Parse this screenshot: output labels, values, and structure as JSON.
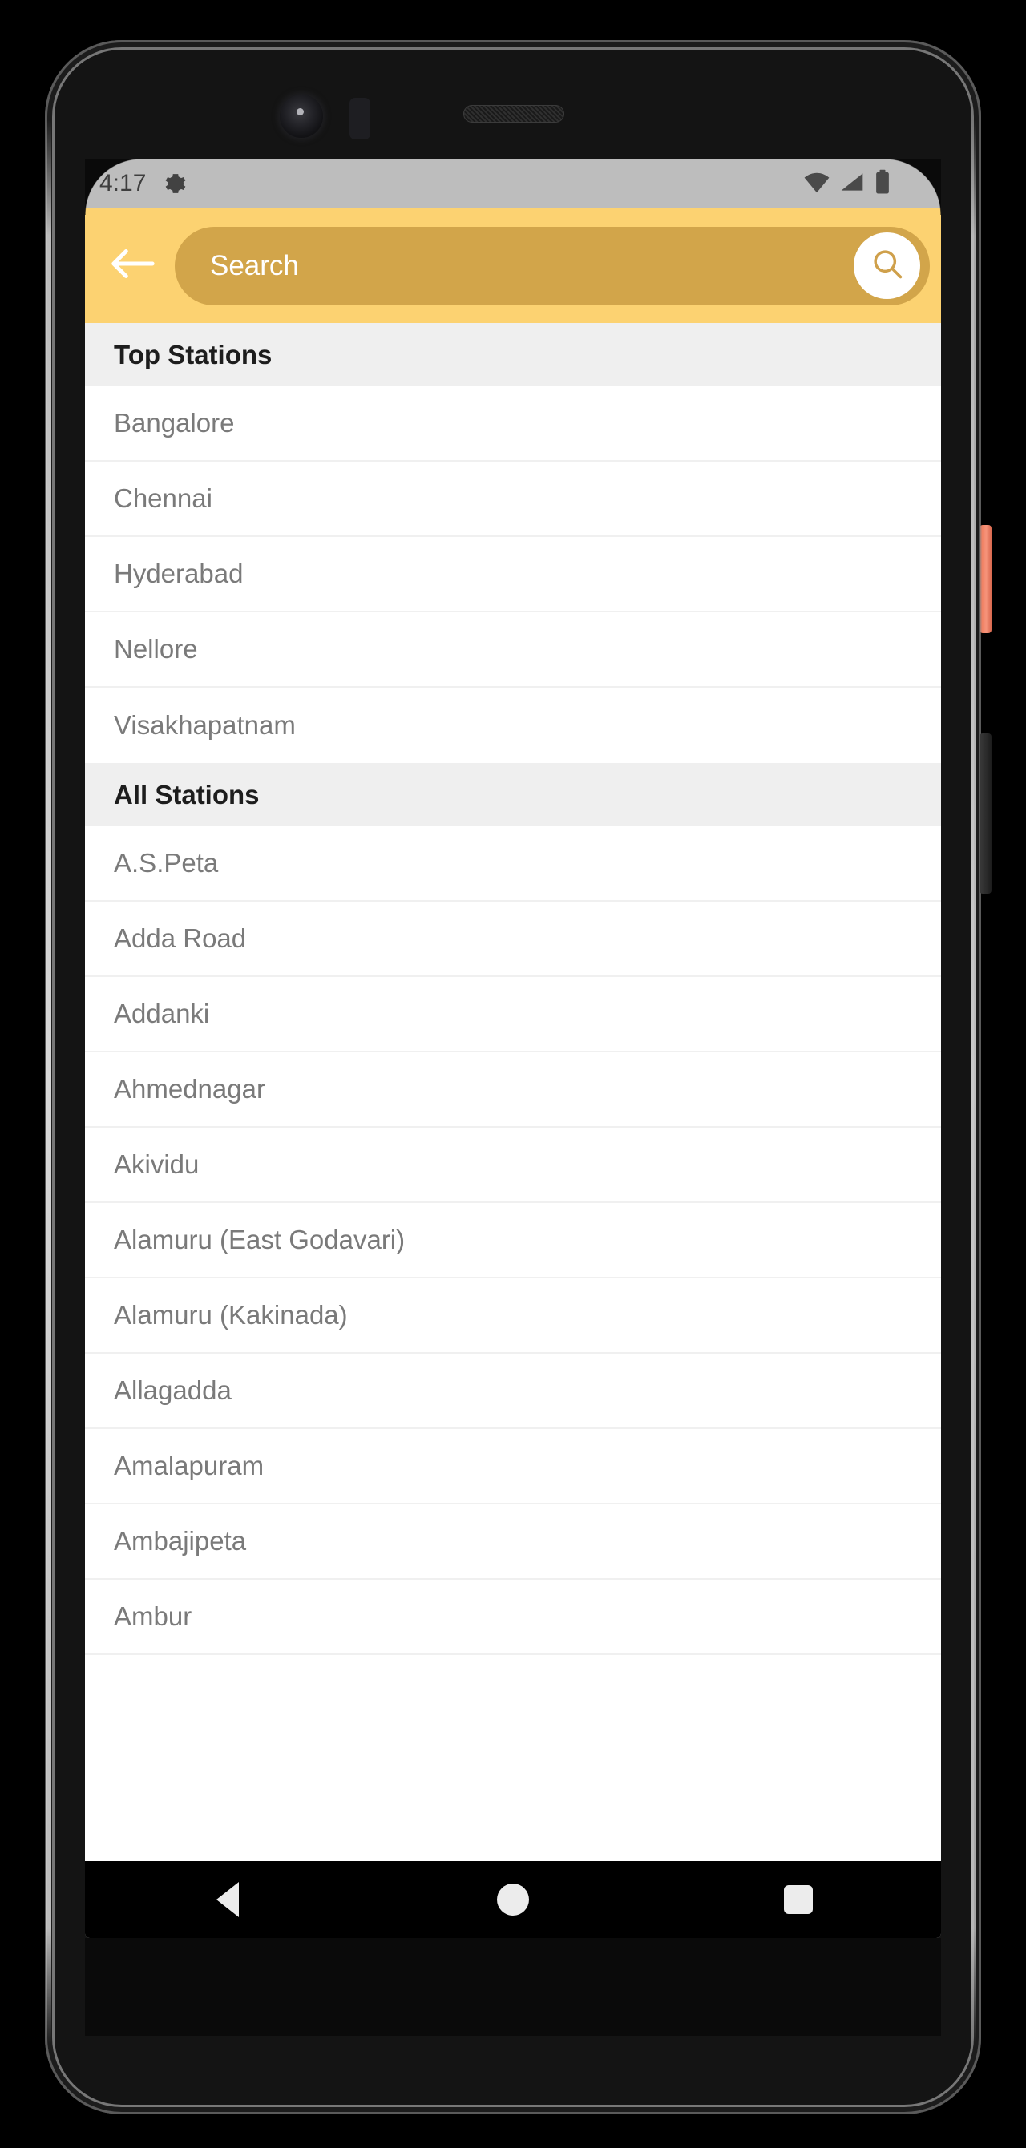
{
  "status_bar": {
    "time": "4:17",
    "icons": [
      "gear-icon",
      "wifi-icon",
      "cellular-signal-icon",
      "battery-full-icon"
    ],
    "background_color": "#BDBDBD",
    "foreground_color": "#3E3E3E"
  },
  "app_bar": {
    "background_color": "#FCD271",
    "search_field_color": "#D2A54A",
    "back_icon": "arrow-left-icon",
    "search_placeholder": "Search",
    "search_value": "",
    "search_button_icon": "search-icon",
    "search_button_background": "#FFFFFF",
    "search_button_icon_color": "#D2A54A"
  },
  "sections": [
    {
      "header": "Top Stations",
      "stations": [
        "Bangalore",
        "Chennai",
        "Hyderabad",
        "Nellore",
        "Visakhapatnam"
      ]
    },
    {
      "header": "All Stations",
      "stations": [
        "A.S.Peta",
        "Adda Road",
        "Addanki",
        "Ahmednagar",
        "Akividu",
        "Alamuru (East Godavari)",
        "Alamuru (Kakinada)",
        "Allagadda",
        "Amalapuram",
        "Ambajipeta",
        "Ambur"
      ]
    }
  ],
  "list_style": {
    "header_background": "#EFEFEF",
    "header_text_color": "#1D1D1D",
    "row_background": "#FFFFFF",
    "row_text_color": "#7A7A7A",
    "divider_color": "#F0F0F0"
  },
  "navigation_bar": {
    "background_color": "#000000",
    "buttons": [
      {
        "name": "back",
        "icon": "triangle-left-icon"
      },
      {
        "name": "home",
        "icon": "circle-icon"
      },
      {
        "name": "recents",
        "icon": "square-icon"
      }
    ]
  },
  "hardware": {
    "power_button_color": "#F28264",
    "volume_button_color": "#2A2A2A",
    "frame_color": "#141414"
  }
}
